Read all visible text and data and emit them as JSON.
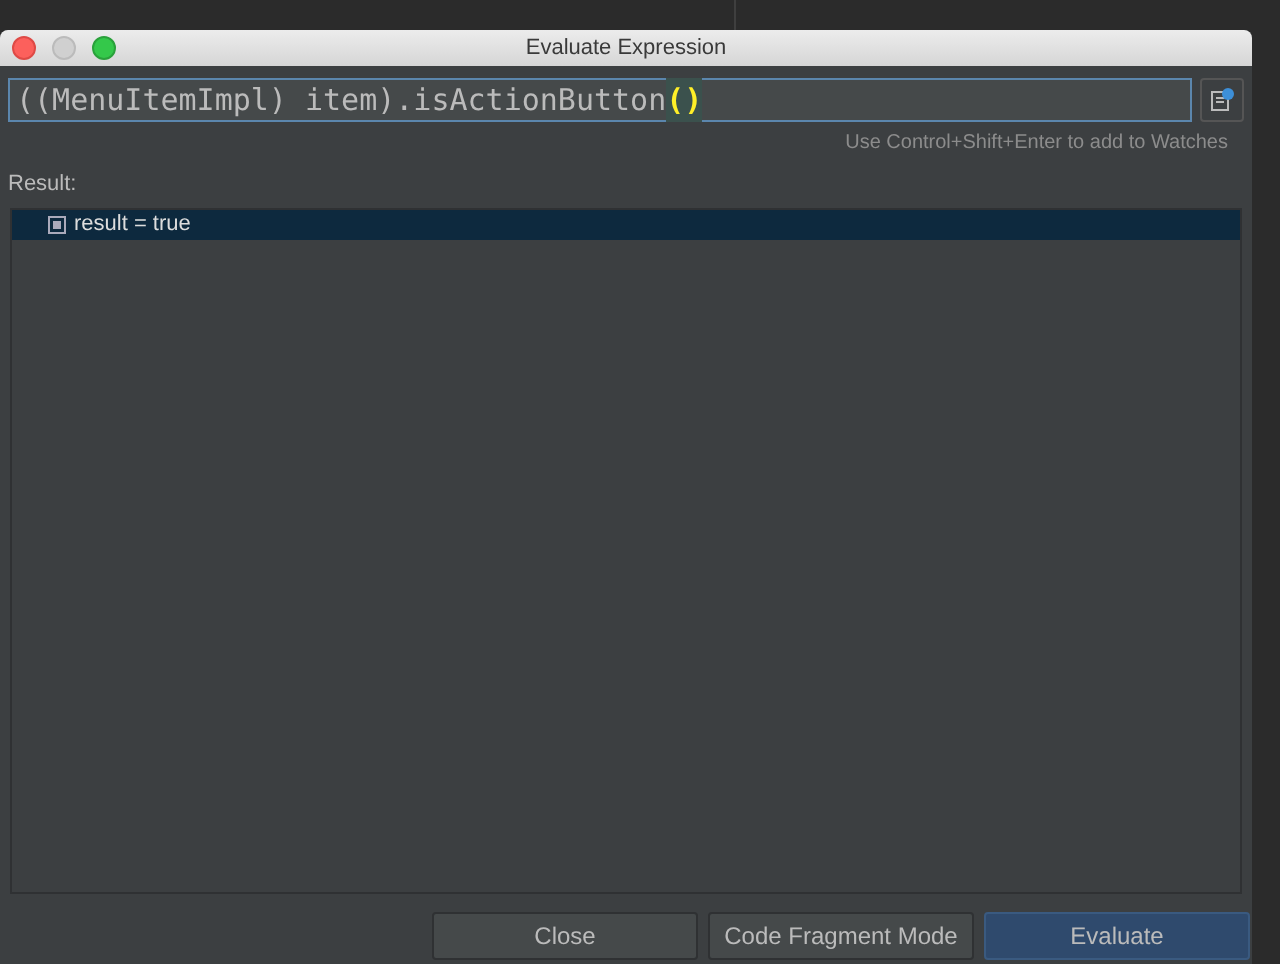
{
  "window": {
    "title": "Evaluate Expression"
  },
  "expression": {
    "parts": [
      {
        "text": "((MenuItemImpl) item).isActionButton",
        "highlighted": false
      },
      {
        "text": "()",
        "highlighted": true
      }
    ]
  },
  "hint": "Use Control+Shift+Enter to add to Watches",
  "result": {
    "label": "Result:",
    "rows": [
      {
        "text": "result = true",
        "selected": true
      }
    ]
  },
  "buttons": [
    {
      "label": "Close",
      "default": false
    },
    {
      "label": "Code Fragment Mode",
      "default": false
    },
    {
      "label": "Evaluate",
      "default": true
    }
  ]
}
